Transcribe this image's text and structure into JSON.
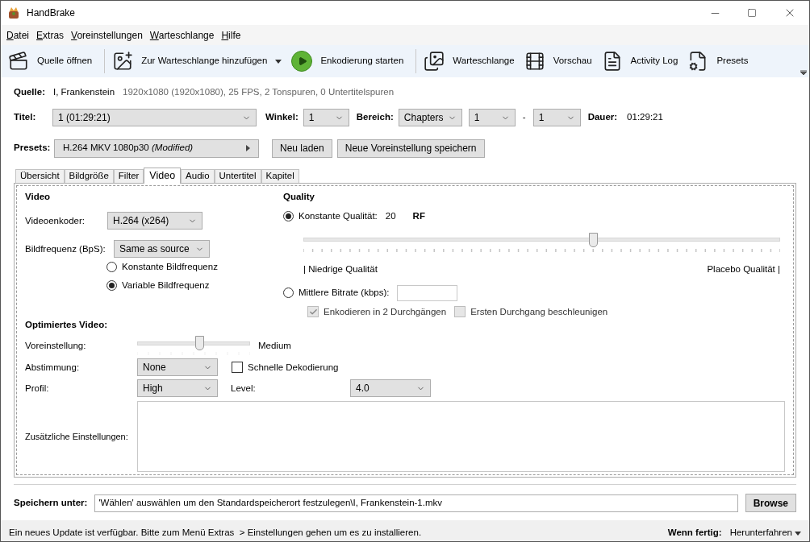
{
  "window": {
    "title": "HandBrake"
  },
  "menu": [
    {
      "label": "Datei"
    },
    {
      "label": "Extras"
    },
    {
      "label": "Voreinstellungen"
    },
    {
      "label": "Warteschlange"
    },
    {
      "label": "Hilfe"
    }
  ],
  "toolbar": [
    {
      "label": "Quelle öffnen",
      "dropdown": false
    },
    {
      "label": "Zur Warteschlange hinzufügen",
      "dropdown": true
    },
    {
      "label": "Enkodierung starten",
      "dropdown": false
    },
    {
      "label": "Warteschlange",
      "dropdown": false
    },
    {
      "label": "Vorschau",
      "dropdown": false
    },
    {
      "label": "Activity Log",
      "dropdown": false
    },
    {
      "label": "Presets",
      "dropdown": false
    }
  ],
  "source": {
    "label": "Quelle:",
    "name": "I, Frankenstein",
    "info": "1920x1080 (1920x1080), 25 FPS, 2 Tonspuren, 0 Untertitelspuren"
  },
  "title_row": {
    "title": {
      "label": "Titel:",
      "value": "1 (01:29:21)"
    },
    "angle": {
      "label": "Winkel:",
      "value": "1"
    },
    "range": {
      "label": "Bereich:",
      "type": "Chapters",
      "start": "1",
      "separator": "-",
      "end": "1"
    },
    "duration": {
      "label": "Dauer:",
      "value": "01:29:21"
    }
  },
  "presets": {
    "label": "Presets:",
    "name": "H.264 MKV 1080p30",
    "modifier": "(Modified)",
    "buttons": [
      "Neu laden",
      "Neue Voreinstellung speichern"
    ]
  },
  "tabs": [
    {
      "label": "Übersicht",
      "selected": false
    },
    {
      "label": "Bildgröße",
      "selected": false
    },
    {
      "label": "Filter",
      "selected": false
    },
    {
      "label": "Video",
      "selected": true
    },
    {
      "label": "Audio",
      "selected": false
    },
    {
      "label": "Untertitel",
      "selected": false
    },
    {
      "label": "Kapitel",
      "selected": false
    }
  ],
  "video": {
    "heading": "Video",
    "encoder": {
      "label": "Videoenkoder:",
      "value": "H.264 (x264)"
    },
    "framerate": {
      "label": "Bildfrequenz (BpS):",
      "value": "Same as source"
    },
    "framerate_modes": [
      {
        "label": "Konstante Bildfrequenz",
        "selected": false
      },
      {
        "label": "Variable Bildfrequenz",
        "selected": true
      }
    ]
  },
  "quality": {
    "heading": "Quality",
    "constant": {
      "label": "Konstante Qualität:",
      "selected": true,
      "value": "20",
      "unit": "RF"
    },
    "slider": {
      "level": 0.607,
      "min_label": "| Niedrige Qualität",
      "max_label": "Placebo Qualität |"
    },
    "bitrate": {
      "label": "Mittlere Bitrate (kbps):",
      "selected": false
    },
    "options": [
      {
        "label": "Enkodieren in 2 Durchgängen",
        "checked": true,
        "disabled": true
      },
      {
        "label": "Ersten Durchgang beschleunigen",
        "checked": false,
        "disabled": true
      }
    ]
  },
  "optimized": {
    "heading": "Optimiertes Video:",
    "preset": {
      "label": "Voreinstellung:",
      "level": 0.55,
      "value": "Medium"
    },
    "tune": {
      "label": "Abstimmung:",
      "value": "None"
    },
    "fast_decode": {
      "label": "Schnelle Dekodierung",
      "checked": false
    },
    "profile": {
      "label": "Profil:",
      "value": "High"
    },
    "level": {
      "label": "Level:",
      "value": "4.0"
    },
    "extra": {
      "label": "Zusätzliche Einstellungen:"
    }
  },
  "destination": {
    "label": "Speichern unter:",
    "value": "'Wählen' auswählen um den Standardspeicherort festzulegen\\I, Frankenstein-1.mkv",
    "button": "Browse"
  },
  "status_bar": {
    "message": "Ein neues Update ist verfügbar. Bitte zum Menü Extras  > Einstellungen gehen um es zu installieren.",
    "when_done": {
      "label": "Wenn fertig:",
      "value": "Herunterfahren"
    }
  }
}
